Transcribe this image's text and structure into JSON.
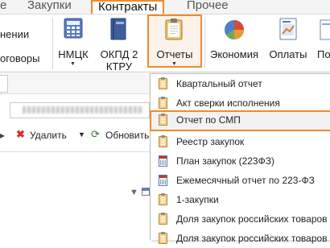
{
  "menu_tabs": [
    {
      "label": "е"
    },
    {
      "label": "Закупки"
    },
    {
      "label": "Контракты"
    },
    {
      "label": "Прочее"
    }
  ],
  "ribbon": {
    "left_labels": [
      "нении",
      "оговоры"
    ],
    "buttons": [
      {
        "label": "НМЦК",
        "icon": "calculator-icon"
      },
      {
        "label": "ОКПД 2 КТРУ",
        "icon": "book-icon"
      },
      {
        "label": "Отчеты",
        "icon": "clipboard-icon"
      },
      {
        "label": "Экономия",
        "icon": "pie-chart-icon"
      },
      {
        "label": "Оплаты",
        "icon": "chart-document-icon"
      },
      {
        "label": "По",
        "icon": "document-icon"
      }
    ]
  },
  "toolbar": {
    "delete_label": "Удалить",
    "refresh_label": "Обновить"
  },
  "dropdown": {
    "items": [
      {
        "label": "Квартальный отчет",
        "icon": "clipboard-icon",
        "highlighted": false
      },
      {
        "label": "Акт сверки исполнения",
        "icon": "clipboard-icon",
        "highlighted": false
      },
      {
        "label": "Отчет по СМП",
        "icon": "clipboard-icon",
        "highlighted": true
      },
      {
        "label": "Реестр закупок",
        "icon": "clipboard-icon",
        "highlighted": false
      },
      {
        "label": "План закупок (223ФЗ)",
        "icon": "calendar-icon",
        "highlighted": false
      },
      {
        "label": "Ежемесячный отчет по 223-ФЗ",
        "icon": "calendar-icon",
        "highlighted": false
      },
      {
        "label": "1-закупки",
        "icon": "clipboard-icon",
        "highlighted": false
      },
      {
        "label": "Доля закупок российских товаров",
        "icon": "clipboard-icon",
        "highlighted": false
      },
      {
        "label": "Доля закупок российских товаров",
        "icon": "clipboard-icon",
        "highlighted": false
      }
    ]
  },
  "colors": {
    "highlight_border": "#ef8b2c",
    "accent_red": "#c0392b"
  }
}
